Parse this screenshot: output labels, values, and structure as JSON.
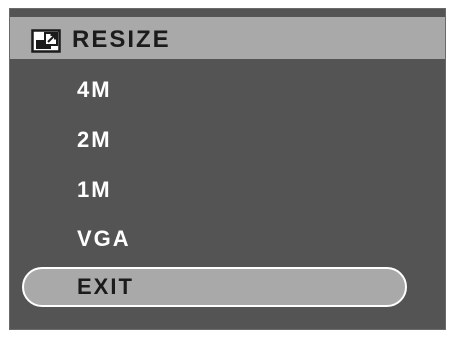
{
  "header": {
    "title": "RESIZE",
    "icon": "resize-icon"
  },
  "menu": {
    "items": [
      {
        "label": "4M",
        "selected": false
      },
      {
        "label": "2M",
        "selected": false
      },
      {
        "label": "1M",
        "selected": false
      },
      {
        "label": "VGA",
        "selected": false
      },
      {
        "label": "EXIT",
        "selected": true
      }
    ]
  },
  "colors": {
    "background": "#545454",
    "header": "#a9a9a9",
    "highlight": "#a9a9a9",
    "text": "#ffffff",
    "dark_text": "#1b1b1b"
  }
}
